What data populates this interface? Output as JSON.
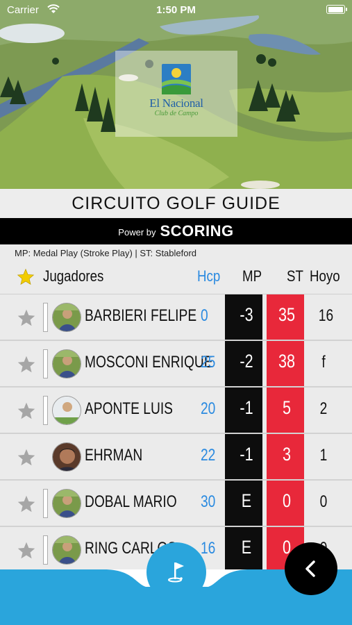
{
  "status_bar": {
    "carrier": "Carrier",
    "time": "1:50 PM",
    "battery_level": 1.0
  },
  "logo": {
    "name": "El Nacional",
    "sub": "Club de Campo"
  },
  "title": "CIRCUITO GOLF GUIDE",
  "power": {
    "label": "Power by",
    "brand": "SCORING"
  },
  "legend": "MP: Medal Play (Stroke Play) | ST: Stableford",
  "headers": {
    "players": "Jugadores",
    "hcp": "Hcp",
    "mp": "MP",
    "st": "ST",
    "hoyo": "Hoyo"
  },
  "players": [
    {
      "name": "BARBIERI FELIPE",
      "hcp": "0",
      "mp": "-3",
      "st": "35",
      "hoyo": "16"
    },
    {
      "name": "MOSCONI ENRIQUE",
      "hcp": "25",
      "mp": "-2",
      "st": "38",
      "hoyo": "f"
    },
    {
      "name": "APONTE LUIS",
      "hcp": "20",
      "mp": "-1",
      "st": "5",
      "hoyo": "2"
    },
    {
      "name": "EHRMAN",
      "hcp": "22",
      "mp": "-1",
      "st": "3",
      "hoyo": "1"
    },
    {
      "name": "DOBAL MARIO",
      "hcp": "30",
      "mp": "E",
      "st": "0",
      "hoyo": "0"
    },
    {
      "name": "RING CARLOS",
      "hcp": "16",
      "mp": "E",
      "st": "0",
      "hoyo": "0"
    }
  ],
  "colors": {
    "hcp": "#2a8ae0",
    "st_column": "#e8283a",
    "mp_column": "#0d0d0d",
    "accent": "#2aa5dc"
  },
  "icons": {
    "favorite": "star-icon",
    "flag": "golf-flag-icon",
    "back": "chevron-left-icon"
  }
}
